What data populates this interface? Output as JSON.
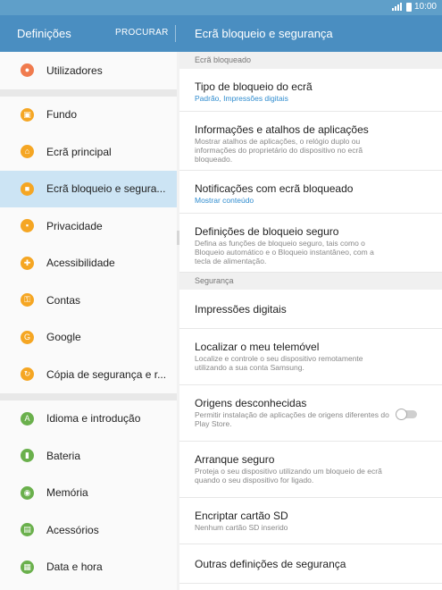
{
  "status": {
    "time": "10:00"
  },
  "appbar": {
    "left_title": "Definições",
    "search_label": "PROCURAR",
    "right_title": "Ecrã bloqueio e segurança"
  },
  "left_menu": {
    "group1": [
      {
        "label": "Utilizadores",
        "icon": "users-icon",
        "color": "#f07b4e"
      }
    ],
    "group2": [
      {
        "label": "Fundo",
        "icon": "image-icon",
        "color": "#f5a623"
      },
      {
        "label": "Ecrã principal",
        "icon": "home-icon",
        "color": "#f5a623"
      },
      {
        "label": "Ecrã bloqueio e segura...",
        "icon": "lock-icon",
        "color": "#f5a623"
      },
      {
        "label": "Privacidade",
        "icon": "privacy-icon",
        "color": "#f5a623"
      },
      {
        "label": "Acessibilidade",
        "icon": "accessibility-icon",
        "color": "#f5a623"
      },
      {
        "label": "Contas",
        "icon": "key-icon",
        "color": "#f5a623"
      },
      {
        "label": "Google",
        "icon": "google-icon",
        "color": "#f5a623"
      },
      {
        "label": "Cópia de segurança e r...",
        "icon": "backup-icon",
        "color": "#f5a623"
      }
    ],
    "group3": [
      {
        "label": "Idioma e introdução",
        "icon": "language-icon",
        "color": "#6ab04c"
      },
      {
        "label": "Bateria",
        "icon": "battery-icon",
        "color": "#6ab04c"
      },
      {
        "label": "Memória",
        "icon": "memory-icon",
        "color": "#6ab04c"
      },
      {
        "label": "Acessórios",
        "icon": "accessories-icon",
        "color": "#6ab04c"
      },
      {
        "label": "Data e hora",
        "icon": "calendar-icon",
        "color": "#6ab04c"
      }
    ]
  },
  "right": {
    "section1": "Ecrã bloqueado",
    "section2": "Segurança",
    "items1": [
      {
        "title": "Tipo de bloqueio do ecrã",
        "sub": "Padrão, Impressões digitais",
        "accent": true
      },
      {
        "title": "Informações e atalhos de aplicações",
        "sub": "Mostrar atalhos de aplicações, o relógio duplo ou informações do proprietário do dispositivo no ecrã bloqueado."
      },
      {
        "title": "Notificações com ecrã bloqueado",
        "sub": "Mostrar conteúdo",
        "accent": true
      },
      {
        "title": "Definições de bloqueio seguro",
        "sub": "Defina as funções de bloqueio seguro, tais como o Bloqueio automático e o Bloqueio instantâneo, com a tecla de alimentação."
      }
    ],
    "items2": [
      {
        "title": "Impressões digitais",
        "sub": ""
      },
      {
        "title": "Localizar o meu telemóvel",
        "sub": "Localize e controle o seu dispositivo remotamente utilizando a sua conta Samsung."
      },
      {
        "title": "Origens desconhecidas",
        "sub": "Permitir instalação de aplicações de origens diferentes do Play Store.",
        "toggle": false
      },
      {
        "title": "Arranque seguro",
        "sub": "Proteja o seu dispositivo utilizando um bloqueio de ecrã quando o seu dispositivo for ligado."
      },
      {
        "title": "Encriptar cartão SD",
        "sub": "Nenhum cartão SD inserido"
      },
      {
        "title": "Outras definições de segurança",
        "sub": ""
      }
    ]
  }
}
